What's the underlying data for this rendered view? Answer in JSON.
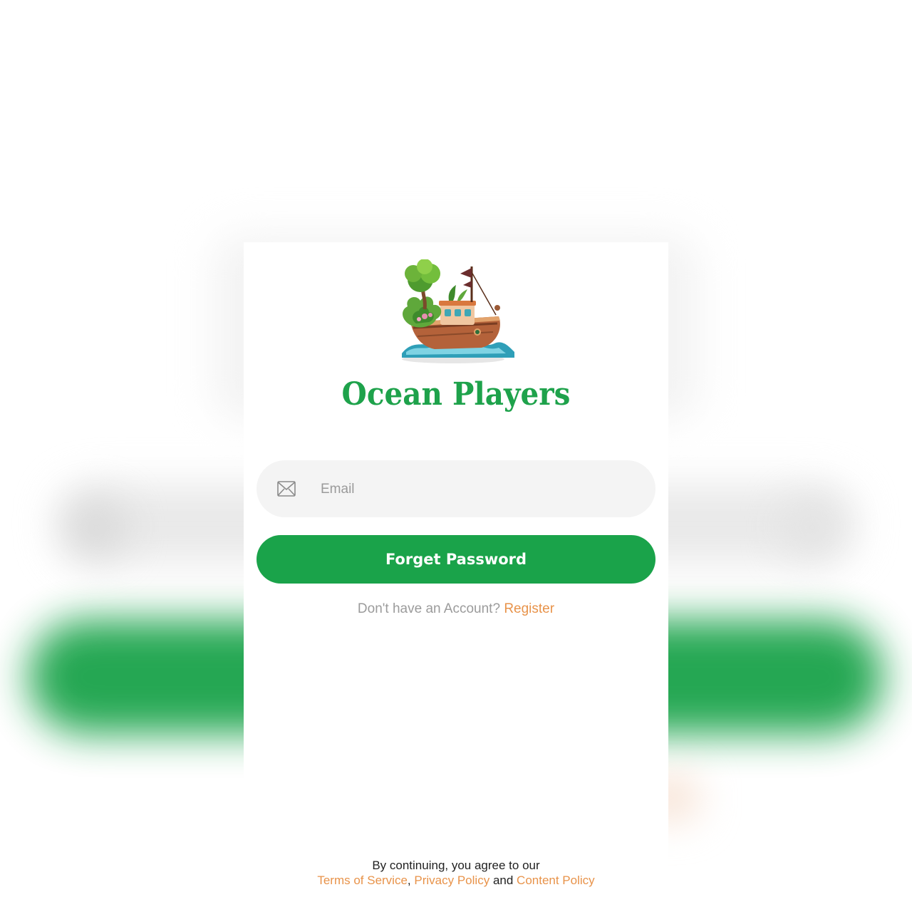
{
  "app": {
    "brand_name": "Ocean Players",
    "brand_color": "#1ea24b",
    "accent_color": "#e8934a"
  },
  "form": {
    "email": {
      "icon": "mail-icon",
      "value": "",
      "placeholder": "Email"
    },
    "submit_label": "Forget Password",
    "submit_color": "#1aa34a"
  },
  "register": {
    "prompt": "Don't have an Account?",
    "link_label": "Register"
  },
  "legal": {
    "intro": "By continuing, you agree to our",
    "terms_label": "Terms of Service",
    "separator": ",",
    "privacy_label": "Privacy Policy",
    "and_text": "and",
    "content_label": "Content Policy"
  }
}
